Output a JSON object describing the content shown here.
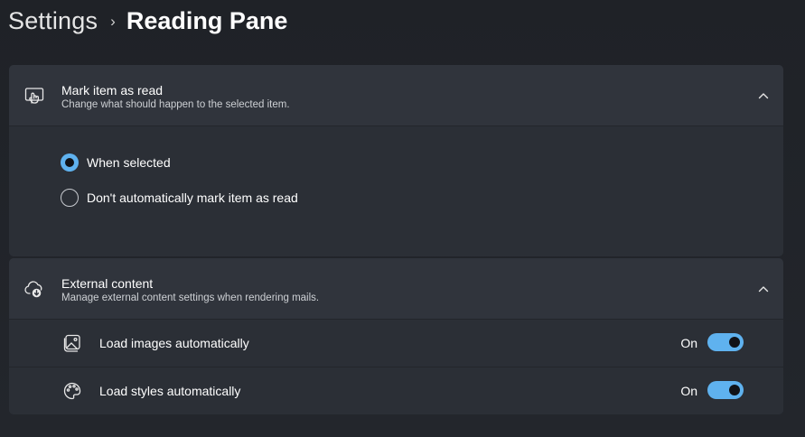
{
  "breadcrumb": {
    "parent": "Settings",
    "separator": "›",
    "current": "Reading Pane"
  },
  "mark_read": {
    "icon": "touch-hand-icon",
    "title": "Mark item as read",
    "description": "Change what should happen to the selected item.",
    "expanded": true,
    "options": [
      {
        "label": "When selected",
        "selected": true
      },
      {
        "label": "Don't automatically mark item as read",
        "selected": false
      }
    ]
  },
  "external_content": {
    "icon": "cloud-download-icon",
    "title": "External content",
    "description": "Manage external content settings when rendering mails.",
    "expanded": true,
    "settings": [
      {
        "icon": "image-icon",
        "label": "Load images automatically",
        "state": "On",
        "enabled": true
      },
      {
        "icon": "palette-icon",
        "label": "Load styles automatically",
        "state": "On",
        "enabled": true
      }
    ]
  },
  "colors": {
    "accent": "#5fb2ef",
    "card": "#2b2f36",
    "card_header": "#30343c",
    "background": "#202328"
  }
}
